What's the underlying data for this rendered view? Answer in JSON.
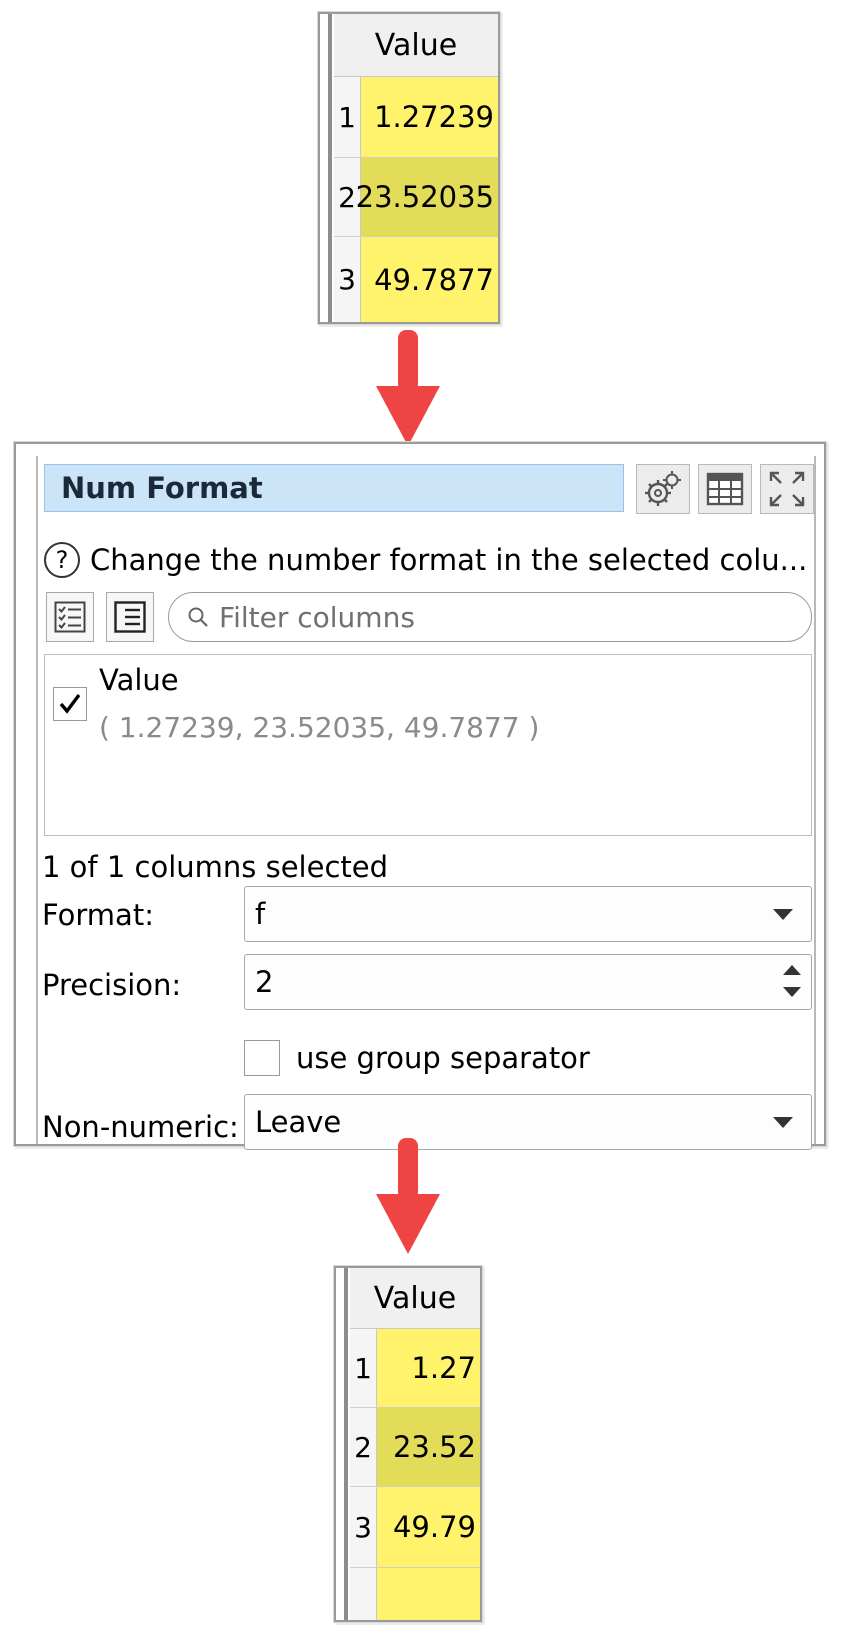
{
  "top_table": {
    "header": "Value",
    "rows": [
      {
        "index": "1",
        "value": "1.27239"
      },
      {
        "index": "2",
        "value": "23.52035"
      },
      {
        "index": "3",
        "value": "49.7877"
      }
    ]
  },
  "panel": {
    "title": "Num Format",
    "description": "Change the number format in the selected colu...",
    "filter_placeholder": "Filter columns",
    "columns": [
      {
        "name": "Value",
        "sample": "( 1.27239, 23.52035, 49.7877 )",
        "checked": true
      }
    ],
    "selected_count": "1 of 1 columns selected",
    "format_label": "Format:",
    "format_value": "f",
    "precision_label": "Precision:",
    "precision_value": "2",
    "group_separator_label": "use group separator",
    "non_numeric_label": "Non-numeric:",
    "non_numeric_value": "Leave"
  },
  "bottom_table": {
    "header": "Value",
    "rows": [
      {
        "index": "1",
        "value": "1.27"
      },
      {
        "index": "2",
        "value": "23.52"
      },
      {
        "index": "3",
        "value": "49.79"
      }
    ]
  },
  "colors": {
    "cell_yellow": "#fff36b",
    "cell_yellow_dark": "#e3dc58",
    "arrow_red": "#ee4444",
    "title_blue": "#cce4f7"
  }
}
